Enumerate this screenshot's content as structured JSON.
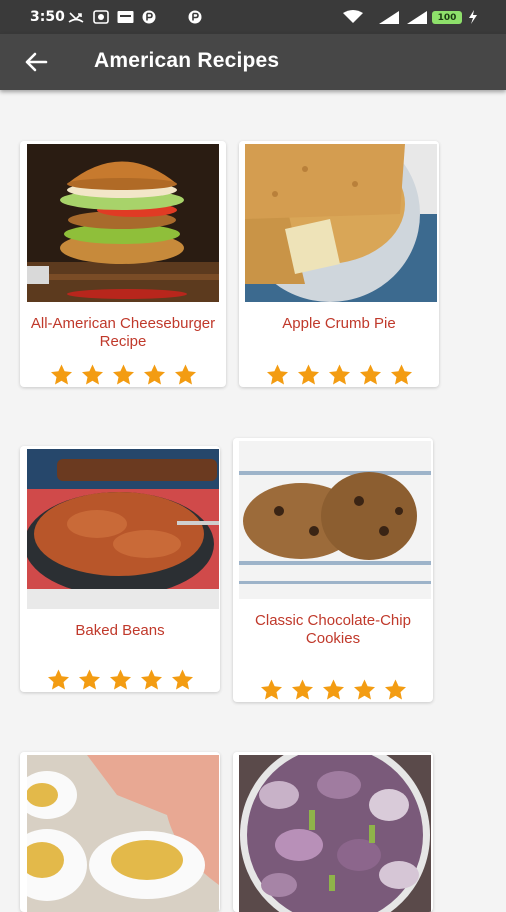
{
  "status_bar": {
    "time": "3:50",
    "battery": "100"
  },
  "header": {
    "title": "American Recipes",
    "back_icon": "arrow-left-icon"
  },
  "recipes": [
    {
      "title": "All-American Cheeseburger Recipe",
      "rating": 5,
      "image": "cheeseburger"
    },
    {
      "title": "Apple Crumb Pie",
      "rating": 5,
      "image": "apple-crumb-pie"
    },
    {
      "title": "Baked Beans",
      "rating": 5,
      "image": "baked-beans"
    },
    {
      "title": "Classic Chocolate-Chip Cookies",
      "rating": 5,
      "image": "chocolate-chip-cookies"
    },
    {
      "image": "deviled-eggs"
    },
    {
      "image": "potato-salad"
    }
  ],
  "colors": {
    "status_bar": "#3a3a3a",
    "app_bar": "#474747",
    "title_text": "#c0392b",
    "star": "#f39c12",
    "background": "#f4f4f4"
  }
}
